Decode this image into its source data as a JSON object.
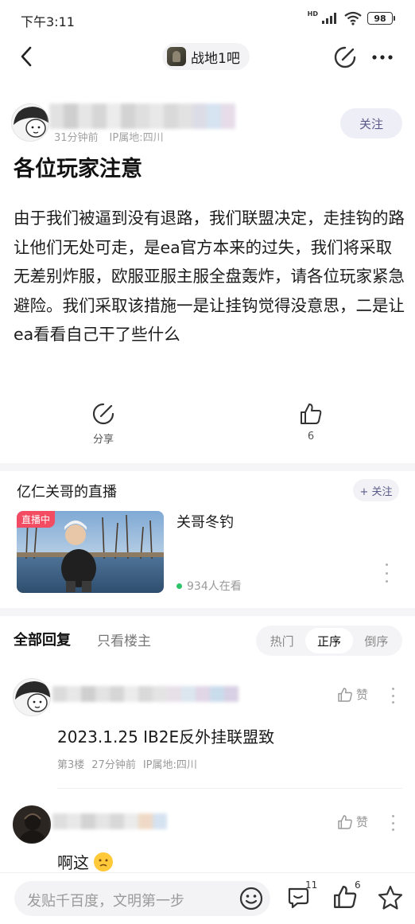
{
  "status_bar": {
    "time": "下午3:11",
    "network_label": "HD",
    "battery": "98"
  },
  "nav": {
    "forum_name": "战地1吧"
  },
  "post": {
    "author_meta": {
      "time": "31分钟前",
      "ip": "IP属地:四川"
    },
    "follow_label": "关注",
    "title": "各位玩家注意",
    "body": "由于我们被逼到没有退路，我们联盟决定，走挂钩的路让他们无处可走，是ea官方本来的过失，我们将采取无差别炸服，欧服亚服主服全盘轰炸，请各位玩家紧急避险。我们采取该措施一是让挂钩觉得没意思，二是让ea看看自己干了些什么",
    "share_label": "分享",
    "like_count": "6"
  },
  "live": {
    "section_title": "亿仁关哥的直播",
    "follow_label": "+ 关注",
    "badge": "直播中",
    "stream_title": "关哥冬钓",
    "viewers": "934人在看"
  },
  "reply_tabs": {
    "all_label": "全部回复",
    "op_only_label": "只看楼主",
    "sort_options": [
      "热门",
      "正序",
      "倒序"
    ],
    "active_sort": "正序"
  },
  "replies": [
    {
      "text": "2023.1.25 IB2E反外挂联盟致",
      "floor": "第3楼",
      "time": "27分钟前",
      "ip": "IP属地:四川",
      "like_label": "赞"
    },
    {
      "text": "啊这",
      "like_label": "赞"
    }
  ],
  "bottom_bar": {
    "placeholder": "发贴千百度，文明第一步",
    "comment_count": "11",
    "like_count": "6"
  },
  "colors": {
    "live_badge": "#f24b62",
    "accent": "#5a5a8a",
    "live_dot": "#2cc36b"
  }
}
